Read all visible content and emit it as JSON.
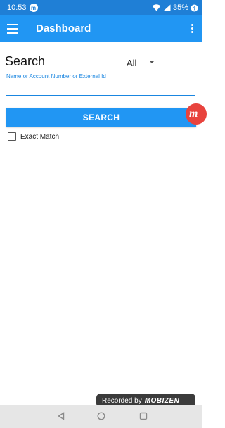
{
  "statusbar": {
    "time": "10:53",
    "app_badge": "m",
    "battery": "35%"
  },
  "appbar": {
    "title": "Dashboard",
    "menu_icon": "hamburger-menu-icon",
    "overflow_icon": "more-vertical-icon"
  },
  "search": {
    "heading": "Search",
    "filter_value": "All",
    "field_label": "Name or Account Number or External Id",
    "field_value": "",
    "button_label": "SEARCH",
    "exact_match_label": "Exact Match",
    "exact_match_checked": false
  },
  "recording": {
    "prefix": "Recorded by",
    "brand": "MOBIZEN"
  },
  "colors": {
    "primary": "#2196f3",
    "status_bar": "#1f7fd6",
    "accent_red": "#e8433d"
  }
}
